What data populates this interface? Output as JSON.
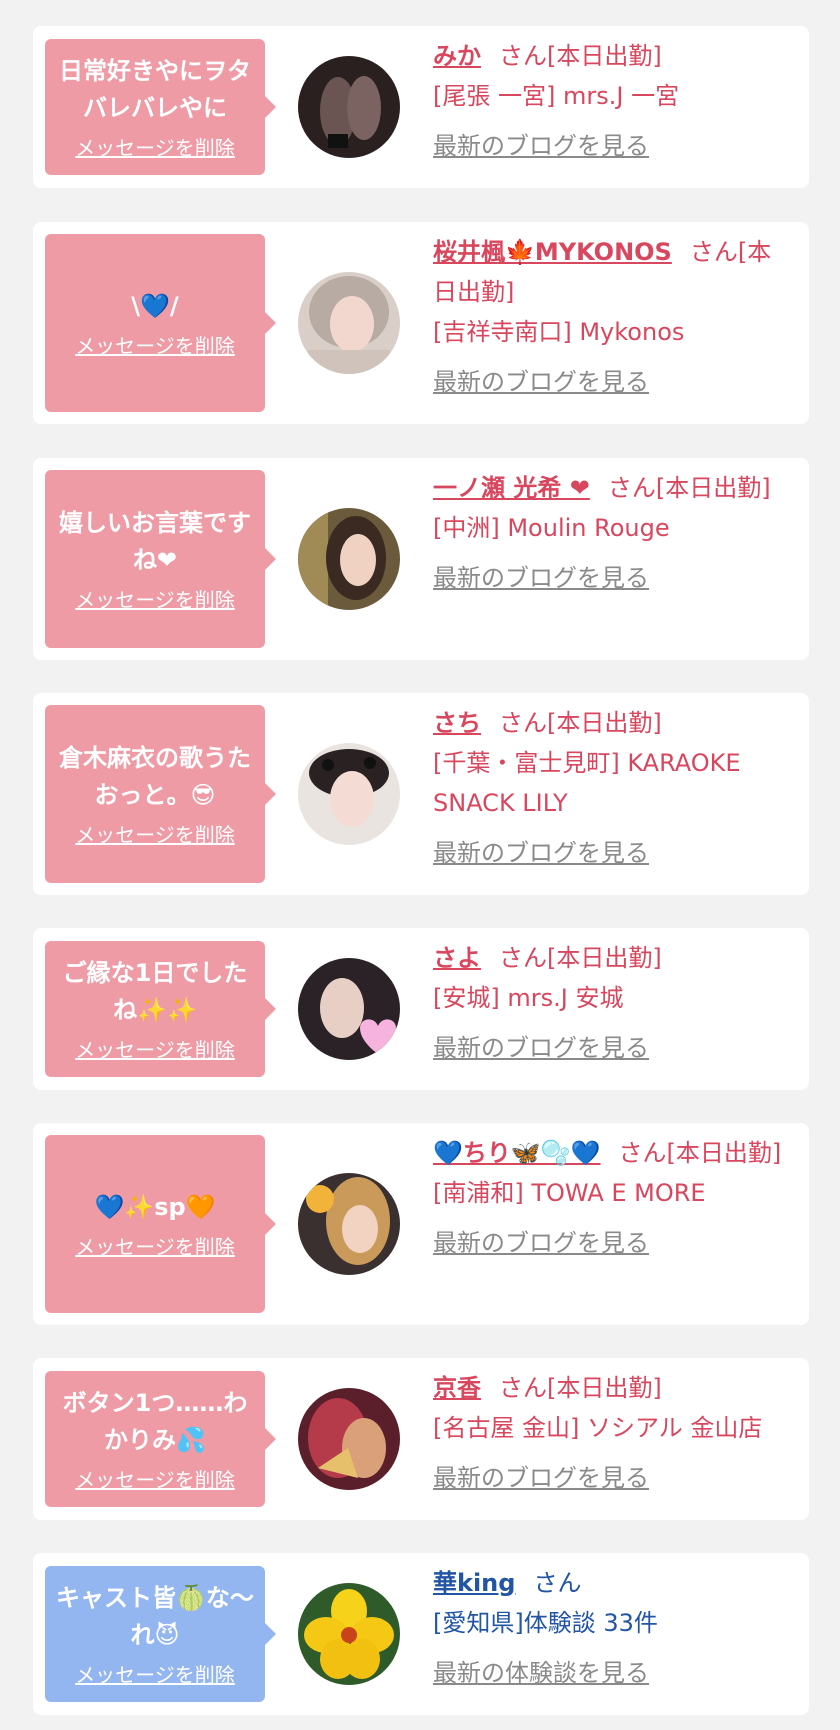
{
  "delete_label": "メッセージを削除",
  "colors": {
    "page_background": "#f2f2f2",
    "card_background": "#ffffff",
    "bubble_pink": "#ef9ba6",
    "bubble_blue": "#93b6f0",
    "name_pink": "#d8475e",
    "name_blue": "#2255a6",
    "link_gray": "#8a8a8a"
  },
  "entries": [
    {
      "message": "日常好きやにヲタバレバレやに",
      "name": "みか",
      "suffix": "さん[本日出勤]",
      "shop": "[尾張 一宮] mrs.J 一宮",
      "blog_link": "最新のブログを見る"
    },
    {
      "message": "\\💙/",
      "name": "桜井楓🍁MYKONOS",
      "suffix": "さん[本日出勤]",
      "shop": "[吉祥寺南口] Mykonos",
      "blog_link": "最新のブログを見る"
    },
    {
      "message": "嬉しいお言葉ですね❤",
      "name": "一ノ瀬 光希 ❤",
      "suffix": "さん[本日出勤]",
      "shop": "[中洲] Moulin Rouge",
      "blog_link": "最新のブログを見る"
    },
    {
      "message": "倉木麻衣の歌うたおっと。😎",
      "name": "さち",
      "suffix": "さん[本日出勤]",
      "shop": "[千葉・富士見町] KARAOKE SNACK LILY",
      "blog_link": "最新のブログを見る"
    },
    {
      "message": "ご縁な1日でしたね✨✨",
      "name": "さよ",
      "suffix": "さん[本日出勤]",
      "shop": "[安城] mrs.J 安城",
      "blog_link": "最新のブログを見る"
    },
    {
      "message": "💙✨sp🧡",
      "name": "💙ちり🦋🫧💙",
      "suffix": "さん[本日出勤]",
      "shop": "[南浦和] TOWA E MORE",
      "blog_link": "最新のブログを見る"
    },
    {
      "message": "ボタン1つ……わかりみ💦",
      "name": "京香",
      "suffix": "さん[本日出勤]",
      "shop": "[名古屋 金山] ソシアル 金山店",
      "blog_link": "最新のブログを見る"
    },
    {
      "message": "キャスト皆🍈な〜れ😈",
      "name": "華king",
      "suffix": "さん",
      "shop": "[愛知県]体験談 33件",
      "blog_link": "最新の体験談を見る"
    }
  ]
}
